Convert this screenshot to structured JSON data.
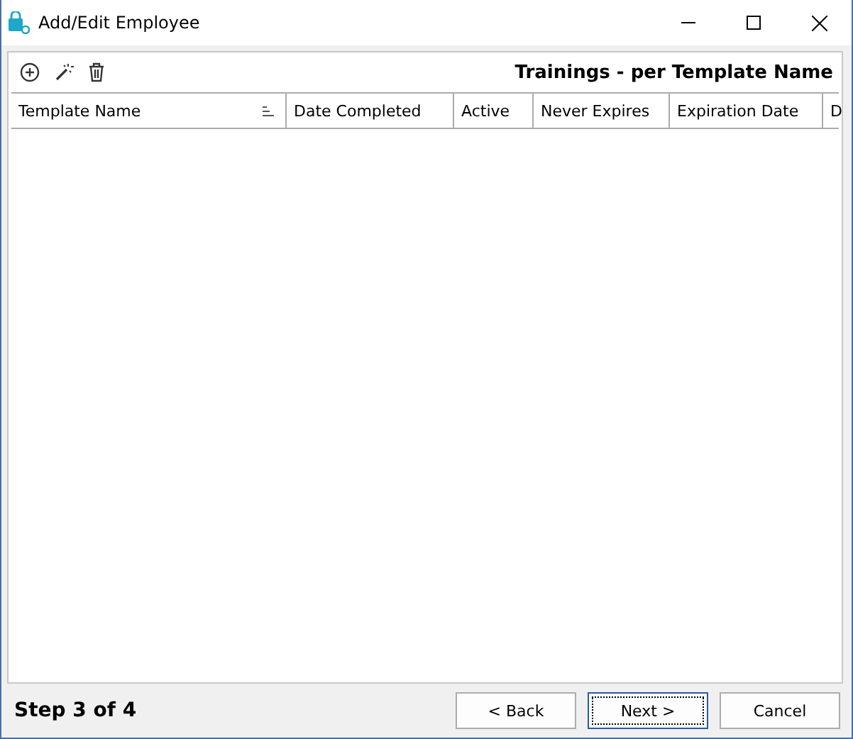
{
  "window": {
    "title": "Add/Edit Employee"
  },
  "panel": {
    "title": "Trainings - per Template Name"
  },
  "table": {
    "columns": [
      {
        "label": "Template Name",
        "sorted": true
      },
      {
        "label": "Date Completed",
        "sorted": false
      },
      {
        "label": "Active",
        "sorted": false
      },
      {
        "label": "Never Expires",
        "sorted": false
      },
      {
        "label": "Expiration Date",
        "sorted": false
      },
      {
        "label": "D",
        "sorted": false
      }
    ]
  },
  "footer": {
    "step": "Step 3 of 4",
    "buttons": [
      {
        "label": "< Back",
        "focused": false
      },
      {
        "label": "Next >",
        "focused": true
      },
      {
        "label": "Cancel",
        "focused": false
      }
    ]
  }
}
